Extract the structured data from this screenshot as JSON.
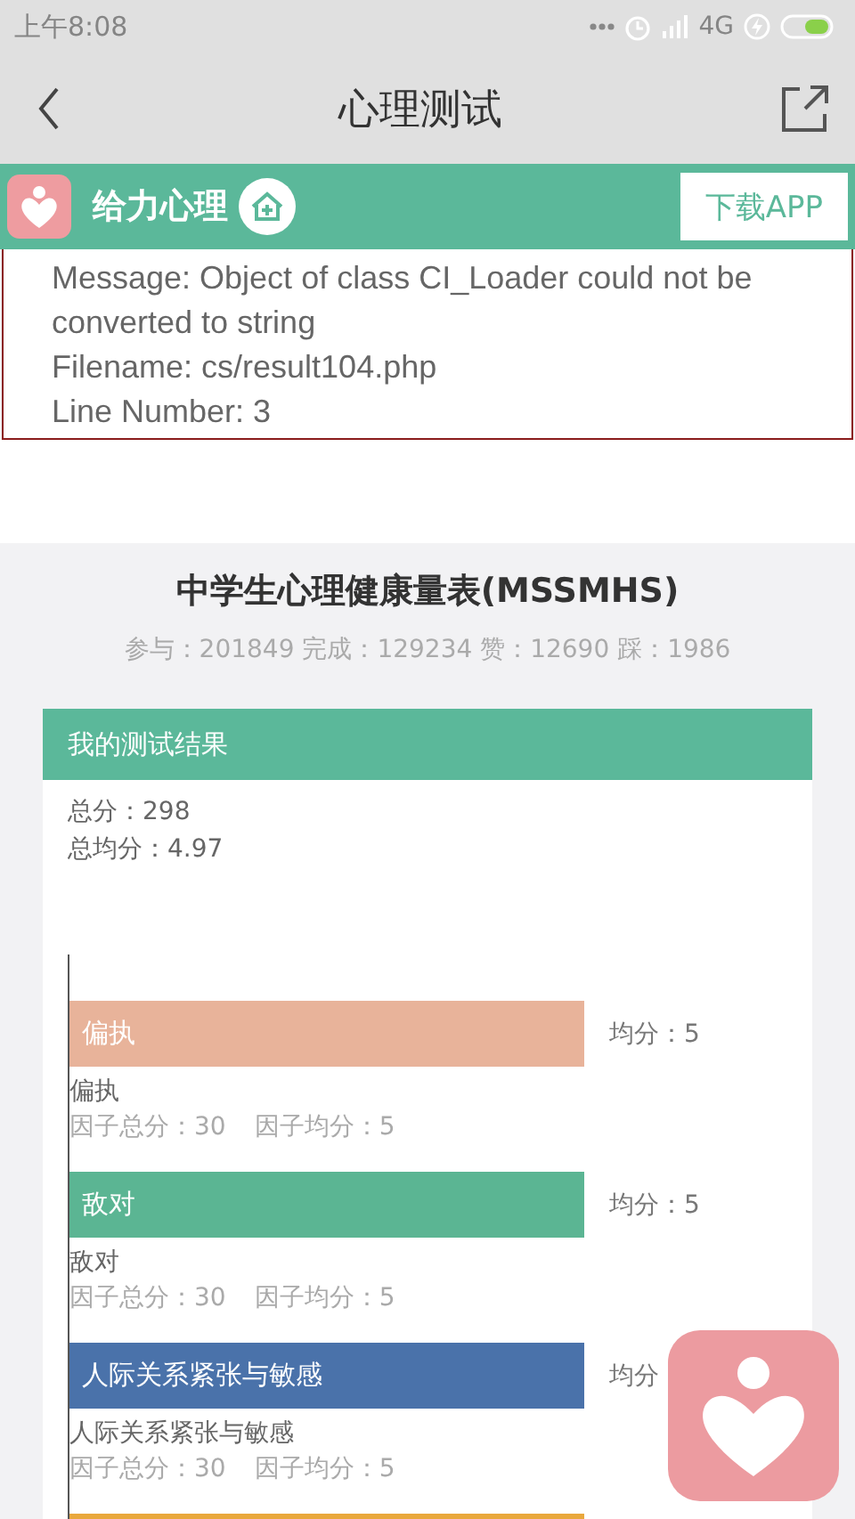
{
  "status_bar": {
    "time": "上午8:08",
    "network": "4G"
  },
  "nav": {
    "title": "心理测试"
  },
  "banner": {
    "brand": "给力心理",
    "button": "下载APP"
  },
  "error": {
    "lines": [
      "Message: Object of class CI_Loader could not be converted to string",
      "Filename: cs/result104.php",
      "Line Number: 3"
    ]
  },
  "test": {
    "title": "中学生心理健康量表(MSSMHS)",
    "stats": "参与：201849 完成：129234 赞：12690 踩：1986"
  },
  "result": {
    "header": "我的测试结果",
    "total": "总分：298",
    "average": "总均分：4.97",
    "factors": [
      {
        "name": "偏执",
        "color": "#e8b39a",
        "score": "均分：5",
        "label": "偏执",
        "factor_total": "因子总分：30",
        "factor_average": "因子均分：5"
      },
      {
        "name": "敌对",
        "color": "#5bb593",
        "score": "均分：5",
        "label": "敌对",
        "factor_total": "因子总分：30",
        "factor_average": "因子均分：5"
      },
      {
        "name": "人际关系紧张与敏感",
        "color": "#4a72aa",
        "score": "均分",
        "label": "人际关系紧张与敏感",
        "factor_total": "因子总分：30",
        "factor_average": "因子均分：5"
      },
      {
        "color": "#e9a83c"
      }
    ]
  }
}
